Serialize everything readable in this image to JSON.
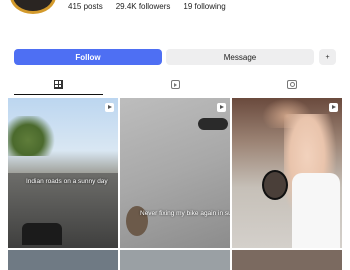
{
  "profile": {
    "stats": {
      "posts": "415 posts",
      "followers": "29.4K followers",
      "following": "19 following"
    }
  },
  "actions": {
    "follow_label": "Follow",
    "message_label": "Message",
    "add_user_label": "+",
    "follow_color": "#4e6ff3"
  },
  "tabs": [
    {
      "name": "posts",
      "icon": "grid-icon",
      "active": true
    },
    {
      "name": "reels",
      "icon": "reels-icon",
      "active": false
    },
    {
      "name": "tagged",
      "icon": "tagged-icon",
      "active": false
    }
  ],
  "posts": [
    {
      "caption": "Indian roads on a sunny day",
      "has_video_icon": true
    },
    {
      "caption": "Never fixing my bike again in sun",
      "has_video_icon": true
    },
    {
      "caption": "",
      "has_video_icon": true
    }
  ]
}
